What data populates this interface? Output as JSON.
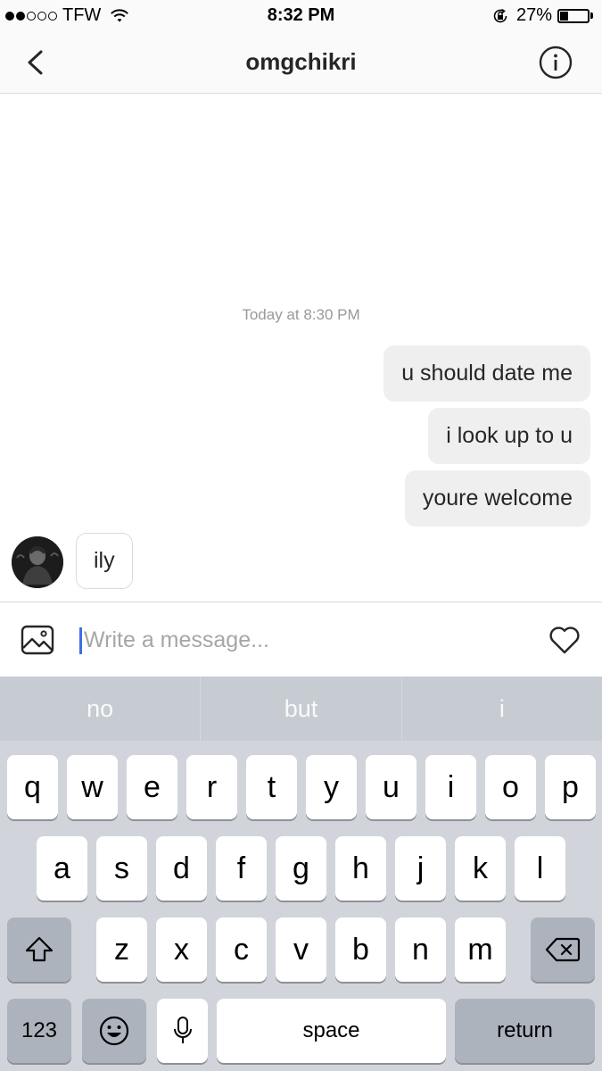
{
  "status_bar": {
    "carrier": "TFW",
    "time": "8:32 PM",
    "battery": "27%",
    "battery_level": 0.27,
    "signal_bars_filled": 2,
    "signal_bars_total": 5
  },
  "header": {
    "title": "omgchikri",
    "back_icon": "chevron-left-icon",
    "info_icon": "info-circle-icon"
  },
  "conversation": {
    "timestamp": "Today at 8:30 PM",
    "outgoing": [
      {
        "text": "u should date me"
      },
      {
        "text": "i look up to u"
      },
      {
        "text": "youre welcome"
      }
    ],
    "incoming": [
      {
        "text": "ily"
      }
    ]
  },
  "composer": {
    "placeholder": "Write a message...",
    "value": "",
    "gallery_icon": "image-icon",
    "like_icon": "heart-icon"
  },
  "keyboard": {
    "suggestions": [
      "no",
      "but",
      "i"
    ],
    "row1": [
      "q",
      "w",
      "e",
      "r",
      "t",
      "y",
      "u",
      "i",
      "o",
      "p"
    ],
    "row2": [
      "a",
      "s",
      "d",
      "f",
      "g",
      "h",
      "j",
      "k",
      "l"
    ],
    "row3": [
      "z",
      "x",
      "c",
      "v",
      "b",
      "n",
      "m"
    ],
    "numbers_label": "123",
    "space_label": "space",
    "return_label": "return",
    "shift_icon": "shift-icon",
    "delete_icon": "backspace-icon",
    "emoji_icon": "emoji-icon",
    "mic_icon": "microphone-icon"
  },
  "colors": {
    "accent_cursor": "#3b6ee8",
    "bubble_outgoing": "#efefef",
    "keyboard_bg": "#d1d5db"
  }
}
